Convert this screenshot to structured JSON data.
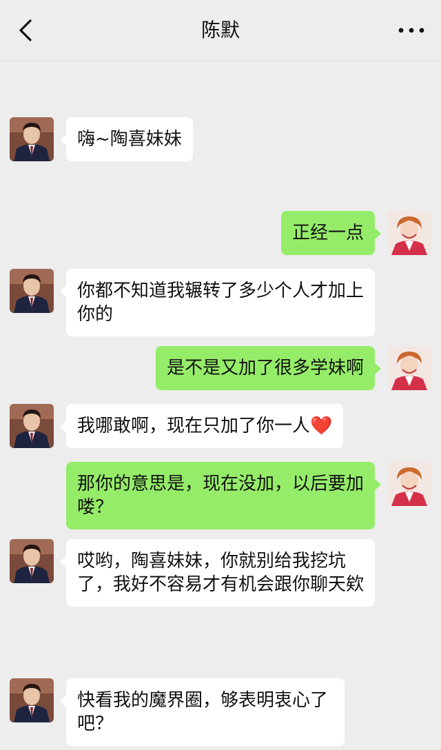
{
  "header": {
    "title": "陈默",
    "back_icon": "chevron-left-icon",
    "more_icon": "more-dots-icon"
  },
  "colors": {
    "background": "#ededed",
    "incoming_bubble": "#ffffff",
    "outgoing_bubble": "#95ec69",
    "heart": "#e5202e"
  },
  "messages": [
    {
      "side": "in",
      "text": "嗨~陶喜妹妹"
    },
    {
      "side": "out",
      "text": "正经一点"
    },
    {
      "side": "in",
      "text": "你都不知道我辗转了多少个人才加上你的"
    },
    {
      "side": "out",
      "text": "是不是又加了很多学妹啊"
    },
    {
      "side": "in",
      "text": "我哪敢啊，现在只加了你一人",
      "emoji": "❤️"
    },
    {
      "side": "out",
      "text": "那你的意思是，现在没加，以后要加喽？"
    },
    {
      "side": "in",
      "text": "哎哟，陶喜妹妹，你就别给我挖坑了，我好不容易才有机会跟你聊天欸"
    },
    {
      "side": "in",
      "text": "快看我的魔界圈，够表明衷心了吧？"
    }
  ]
}
